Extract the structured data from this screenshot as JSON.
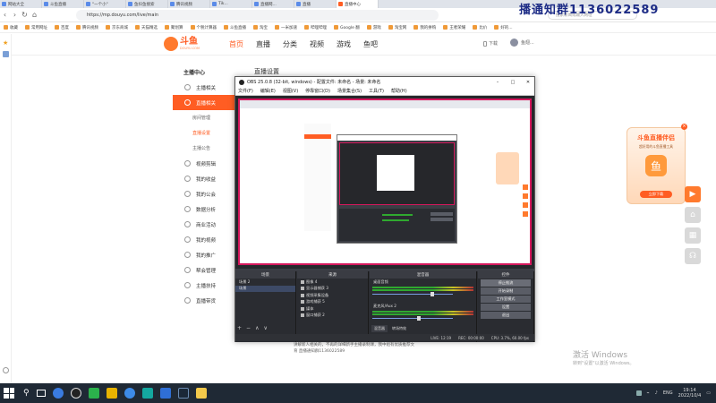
{
  "browser": {
    "tabs": [
      {
        "label": "网站大全"
      },
      {
        "label": "斗鱼直播"
      },
      {
        "label": "\"一个小\""
      },
      {
        "label": "鱼抖鱼搜索"
      },
      {
        "label": "腾讯视频"
      },
      {
        "label": "Tik..."
      },
      {
        "label": "直播网..."
      },
      {
        "label": "直播"
      },
      {
        "label": "直播中心"
      }
    ],
    "url": "https://mp.douyu.com/live/main",
    "search_placeholder": "搜索新闻或输入网址",
    "bookmarks": [
      "收藏",
      "常用网址",
      "百度",
      "腾讯视频",
      "京东商城",
      "天猫精选",
      "聚划算",
      "个税计算器",
      "斗鱼直播",
      "淘宝",
      "一米加速",
      "哔哩哔哩",
      "Google 翻",
      "游戏",
      "淘宝网",
      "我的拼购",
      "王者荣耀",
      "比价",
      "好的..."
    ],
    "watermark": "播通知群1136022589"
  },
  "douyu": {
    "logo_text": "斗鱼",
    "logo_sub": "DOUYU.COM",
    "nav": [
      "首页",
      "直播",
      "分类",
      "视频",
      "游戏",
      "鱼吧"
    ],
    "header_right": [
      "下载"
    ],
    "user_name": "鱼翅..."
  },
  "menu": {
    "heading": "主播中心",
    "items": [
      {
        "label": "主播相关"
      },
      {
        "label": "直播相关",
        "active": true
      },
      {
        "label": "房间管理",
        "sub": true
      },
      {
        "label": "直播设置",
        "sub": true,
        "selected": true
      },
      {
        "label": "主播公告",
        "sub": true
      },
      {
        "label": "视频剪辑"
      },
      {
        "label": "我的收益"
      },
      {
        "label": "我的公会"
      },
      {
        "label": "数据分析"
      },
      {
        "label": "商业活动"
      },
      {
        "label": "我的视频"
      },
      {
        "label": "我的推广"
      },
      {
        "label": "帮会管理"
      },
      {
        "label": "主播扶持"
      },
      {
        "label": "直播带货"
      }
    ]
  },
  "content": {
    "title": "直播设置",
    "bottom_text_1": "讲解新人相关的，不再的详细新手主播录制课，我中组有优质推荐文",
    "bottom_text_2": "育 直播通知群1136022589"
  },
  "obs": {
    "title": "OBS 25.0.8 (32-bit, windows) - 配置文件: 未命名 - 场景: 未命名",
    "menu": [
      "文件(F)",
      "编辑(E)",
      "视图(V)",
      "停靠窗口(D)",
      "场景集合(S)",
      "工具(T)",
      "帮助(H)"
    ],
    "docks": {
      "scenes": {
        "title": "场景",
        "items": [
          "场景 2",
          "场景"
        ]
      },
      "sources": {
        "title": "来源",
        "items": [
          "图像 4",
          "显示器捕获 3",
          "视频采集设备",
          "游戏捕获 5",
          "媒体",
          "窗口捕获 2"
        ]
      },
      "mixer": {
        "title": "混音器",
        "channels": [
          "桌面音频",
          "麦克风/Aux 2"
        ],
        "levels": [
          0.72,
          0.55
        ]
      },
      "transitions": {
        "title": "转场特效"
      },
      "controls": {
        "title": "控件",
        "buttons": [
          "停止推流",
          "开始录制",
          "工作室模式",
          "设置",
          "退出"
        ]
      }
    },
    "status": [
      "LIVE: 12:19",
      "REC: 00:00:00",
      "CPU: 3.7%, 60.00 fps"
    ]
  },
  "banner": {
    "title": "斗鱼直播伴侣",
    "subtitle": "超好用的斗鱼直播工具",
    "button": "立即下载",
    "mascot": "鱼"
  },
  "sidebar_float": [
    "视频",
    "首页",
    "客服",
    "反馈"
  ],
  "taskbar": {
    "time": "19:14",
    "date": "2022/10/4",
    "lang": "ENG"
  },
  "windows_watermark": {
    "line1": "激活 Windows",
    "line2": "转到\"设置\"以激活 Windows。"
  },
  "colors": {
    "accent": "#ff5d23",
    "obs_bg": "#3b3d44",
    "preview_border": "#d5175c"
  }
}
